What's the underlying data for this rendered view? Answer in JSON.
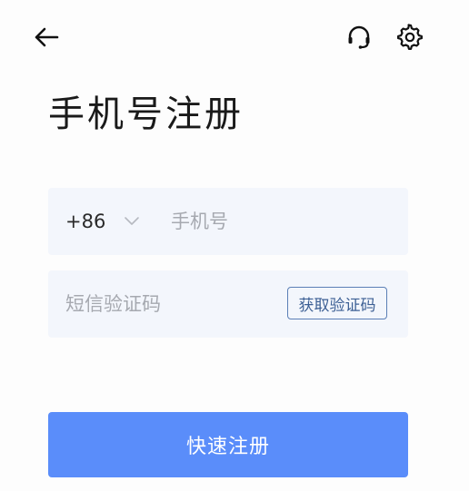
{
  "header": {
    "back_icon": "arrow-left-icon",
    "support_icon": "headset-icon",
    "settings_icon": "gear-icon"
  },
  "title": "手机号注册",
  "phone_field": {
    "country_code": "+86",
    "chevron_icon": "chevron-down-icon",
    "placeholder": "手机号",
    "value": ""
  },
  "code_field": {
    "placeholder": "短信验证码",
    "value": "",
    "get_code_label": "获取验证码"
  },
  "submit": {
    "label": "快速注册"
  },
  "colors": {
    "primary_button": "#5a8dfa",
    "field_background": "#f3f6fc",
    "outline_button": "#5b7fb6",
    "placeholder": "#a6a9b0",
    "title": "#1a1a1a"
  }
}
